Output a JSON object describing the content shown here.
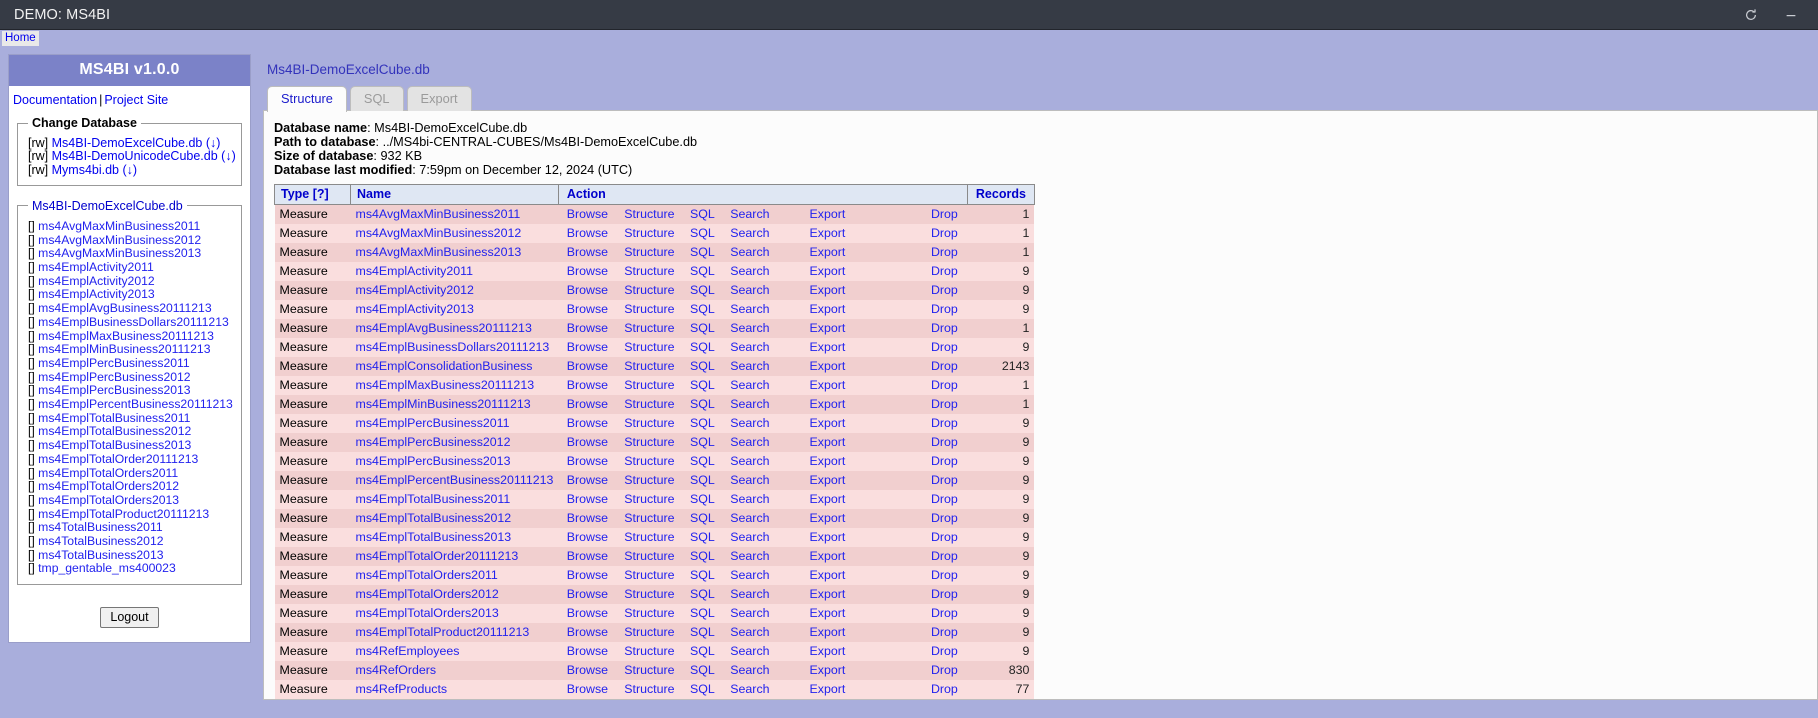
{
  "titlebar": {
    "title": "DEMO: MS4BI",
    "refresh_icon": "refresh-icon",
    "minimize_icon": "minimize-icon"
  },
  "homebar": {
    "home_label": "Home"
  },
  "sidebar": {
    "header": "MS4BI v1.0.0",
    "links": {
      "documentation": "Documentation",
      "separator": "|",
      "project_site": "Project Site"
    },
    "change_database": {
      "legend": "Change Database",
      "items": [
        {
          "rw": "[rw]",
          "name": "Ms4BI-DemoExcelCube.db",
          "download": "(↓)"
        },
        {
          "rw": "[rw]",
          "name": "Ms4BI-DemoUnicodeCube.db",
          "download": "(↓)"
        },
        {
          "rw": "[rw]",
          "name": "Myms4bi.db",
          "download": "(↓)"
        }
      ]
    },
    "tables_panel": {
      "legend": "Ms4BI-DemoExcelCube.db",
      "bracket": "[]",
      "items": [
        "ms4AvgMaxMinBusiness2011",
        "ms4AvgMaxMinBusiness2012",
        "ms4AvgMaxMinBusiness2013",
        "ms4EmplActivity2011",
        "ms4EmplActivity2012",
        "ms4EmplActivity2013",
        "ms4EmplAvgBusiness20111213",
        "ms4EmplBusinessDollars20111213",
        "ms4EmplMaxBusiness20111213",
        "ms4EmplMinBusiness20111213",
        "ms4EmplPercBusiness2011",
        "ms4EmplPercBusiness2012",
        "ms4EmplPercBusiness2013",
        "ms4EmplPercentBusiness20111213",
        "ms4EmplTotalBusiness2011",
        "ms4EmplTotalBusiness2012",
        "ms4EmplTotalBusiness2013",
        "ms4EmplTotalOrder20111213",
        "ms4EmplTotalOrders2011",
        "ms4EmplTotalOrders2012",
        "ms4EmplTotalOrders2013",
        "ms4EmplTotalProduct20111213",
        "ms4TotalBusiness2011",
        "ms4TotalBusiness2012",
        "ms4TotalBusiness2013",
        "tmp_gentable_ms400023"
      ]
    },
    "logout_label": "Logout"
  },
  "main": {
    "breadcrumb": "Ms4BI-DemoExcelCube.db",
    "tabs": [
      {
        "label": "Structure",
        "active": true
      },
      {
        "label": "SQL",
        "active": false
      },
      {
        "label": "Export",
        "active": false
      }
    ],
    "db_info": [
      {
        "label": "Database name",
        "value": "Ms4BI-DemoExcelCube.db"
      },
      {
        "label": "Path to database",
        "value": "../MS4bi-CENTRAL-CUBES/Ms4BI-DemoExcelCube.db"
      },
      {
        "label": "Size of database",
        "value": "932 KB"
      },
      {
        "label": "Database last modified",
        "value": "7:59pm on December 12, 2024 (UTC)"
      }
    ],
    "table": {
      "headers": {
        "type": "Type [?]",
        "name": "Name",
        "action": "Action",
        "records": "Records"
      },
      "actions": {
        "browse": "Browse",
        "structure": "Structure",
        "sql": "SQL",
        "search": "Search",
        "export": "Export",
        "drop": "Drop"
      },
      "rows": [
        {
          "type": "Measure",
          "name": "ms4AvgMaxMinBusiness2011",
          "records": "1"
        },
        {
          "type": "Measure",
          "name": "ms4AvgMaxMinBusiness2012",
          "records": "1"
        },
        {
          "type": "Measure",
          "name": "ms4AvgMaxMinBusiness2013",
          "records": "1"
        },
        {
          "type": "Measure",
          "name": "ms4EmplActivity2011",
          "records": "9"
        },
        {
          "type": "Measure",
          "name": "ms4EmplActivity2012",
          "records": "9"
        },
        {
          "type": "Measure",
          "name": "ms4EmplActivity2013",
          "records": "9"
        },
        {
          "type": "Measure",
          "name": "ms4EmplAvgBusiness20111213",
          "records": "1"
        },
        {
          "type": "Measure",
          "name": "ms4EmplBusinessDollars20111213",
          "records": "9"
        },
        {
          "type": "Measure",
          "name": "ms4EmplConsolidationBusiness",
          "records": "2143"
        },
        {
          "type": "Measure",
          "name": "ms4EmplMaxBusiness20111213",
          "records": "1"
        },
        {
          "type": "Measure",
          "name": "ms4EmplMinBusiness20111213",
          "records": "1"
        },
        {
          "type": "Measure",
          "name": "ms4EmplPercBusiness2011",
          "records": "9"
        },
        {
          "type": "Measure",
          "name": "ms4EmplPercBusiness2012",
          "records": "9"
        },
        {
          "type": "Measure",
          "name": "ms4EmplPercBusiness2013",
          "records": "9"
        },
        {
          "type": "Measure",
          "name": "ms4EmplPercentBusiness20111213",
          "records": "9"
        },
        {
          "type": "Measure",
          "name": "ms4EmplTotalBusiness2011",
          "records": "9"
        },
        {
          "type": "Measure",
          "name": "ms4EmplTotalBusiness2012",
          "records": "9"
        },
        {
          "type": "Measure",
          "name": "ms4EmplTotalBusiness2013",
          "records": "9"
        },
        {
          "type": "Measure",
          "name": "ms4EmplTotalOrder20111213",
          "records": "9"
        },
        {
          "type": "Measure",
          "name": "ms4EmplTotalOrders2011",
          "records": "9"
        },
        {
          "type": "Measure",
          "name": "ms4EmplTotalOrders2012",
          "records": "9"
        },
        {
          "type": "Measure",
          "name": "ms4EmplTotalOrders2013",
          "records": "9"
        },
        {
          "type": "Measure",
          "name": "ms4EmplTotalProduct20111213",
          "records": "9"
        },
        {
          "type": "Measure",
          "name": "ms4RefEmployees",
          "records": "9"
        },
        {
          "type": "Measure",
          "name": "ms4RefOrders",
          "records": "830"
        },
        {
          "type": "Measure",
          "name": "ms4RefProducts",
          "records": "77"
        }
      ]
    }
  },
  "colors": {
    "titlebar_bg": "#363b45",
    "page_bg": "#a9aedc",
    "sidebar_header_bg": "#7b82c8",
    "link": "#2222ee",
    "row_odd": "#f1cfcf",
    "row_even": "#fadede",
    "table_header_bg": "#dfe7f3"
  }
}
